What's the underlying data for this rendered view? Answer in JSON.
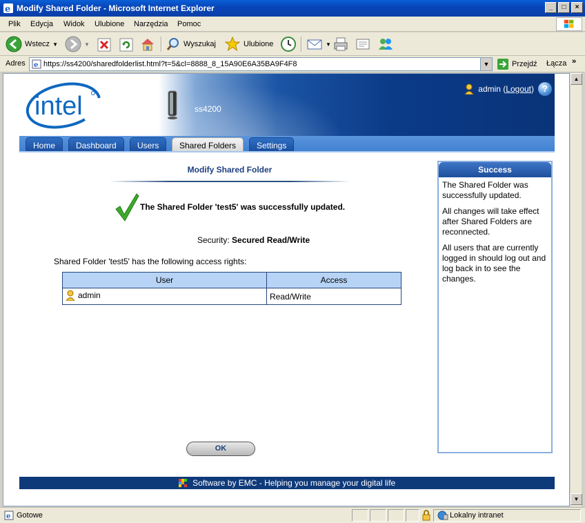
{
  "window": {
    "title": "Modify Shared Folder - Microsoft Internet Explorer"
  },
  "menu": [
    "Plik",
    "Edycja",
    "Widok",
    "Ulubione",
    "Narzędzia",
    "Pomoc"
  ],
  "toolbar": {
    "back": "Wstecz",
    "search": "Wyszukaj",
    "favorites": "Ulubione"
  },
  "address": {
    "label": "Adres",
    "url": "https://ss4200/sharedfolderlist.html?t=5&cl=8888_8_15A90E6A35BA9F4F8",
    "go": "Przejdź",
    "links": "Łącza"
  },
  "header": {
    "device": "ss4200",
    "user": "admin",
    "logout_label": "Logout",
    "help": "?"
  },
  "nav": {
    "tabs": [
      "Home",
      "Dashboard",
      "Users",
      "Shared Folders",
      "Settings"
    ],
    "active": "Shared Folders"
  },
  "main": {
    "title": "Modify Shared Folder",
    "success_message": "The Shared Folder 'test5' was successfully updated.",
    "security_label": "Security:",
    "security_value": "Secured Read/Write",
    "rights_text": "Shared Folder 'test5' has the following access rights:",
    "table": {
      "columns": [
        "User",
        "Access"
      ],
      "rows": [
        {
          "user": "admin",
          "access": "Read/Write"
        }
      ]
    },
    "ok_label": "OK"
  },
  "sidebar": {
    "title": "Success",
    "paragraphs": [
      "The Shared Folder was successfully updated.",
      "All changes will take effect after Shared Folders are reconnected.",
      "All users that are currently logged in should log out and log back in to see the changes."
    ]
  },
  "footer": {
    "text": "Software by EMC - Helping you manage your digital life"
  },
  "status": {
    "text": "Gotowe",
    "zone": "Lokalny intranet"
  },
  "colors": {
    "brand_blue": "#0b3a87",
    "title_blue": "#1c3e80",
    "table_header": "#b7d3f5",
    "check_green": "#3cab2a"
  }
}
